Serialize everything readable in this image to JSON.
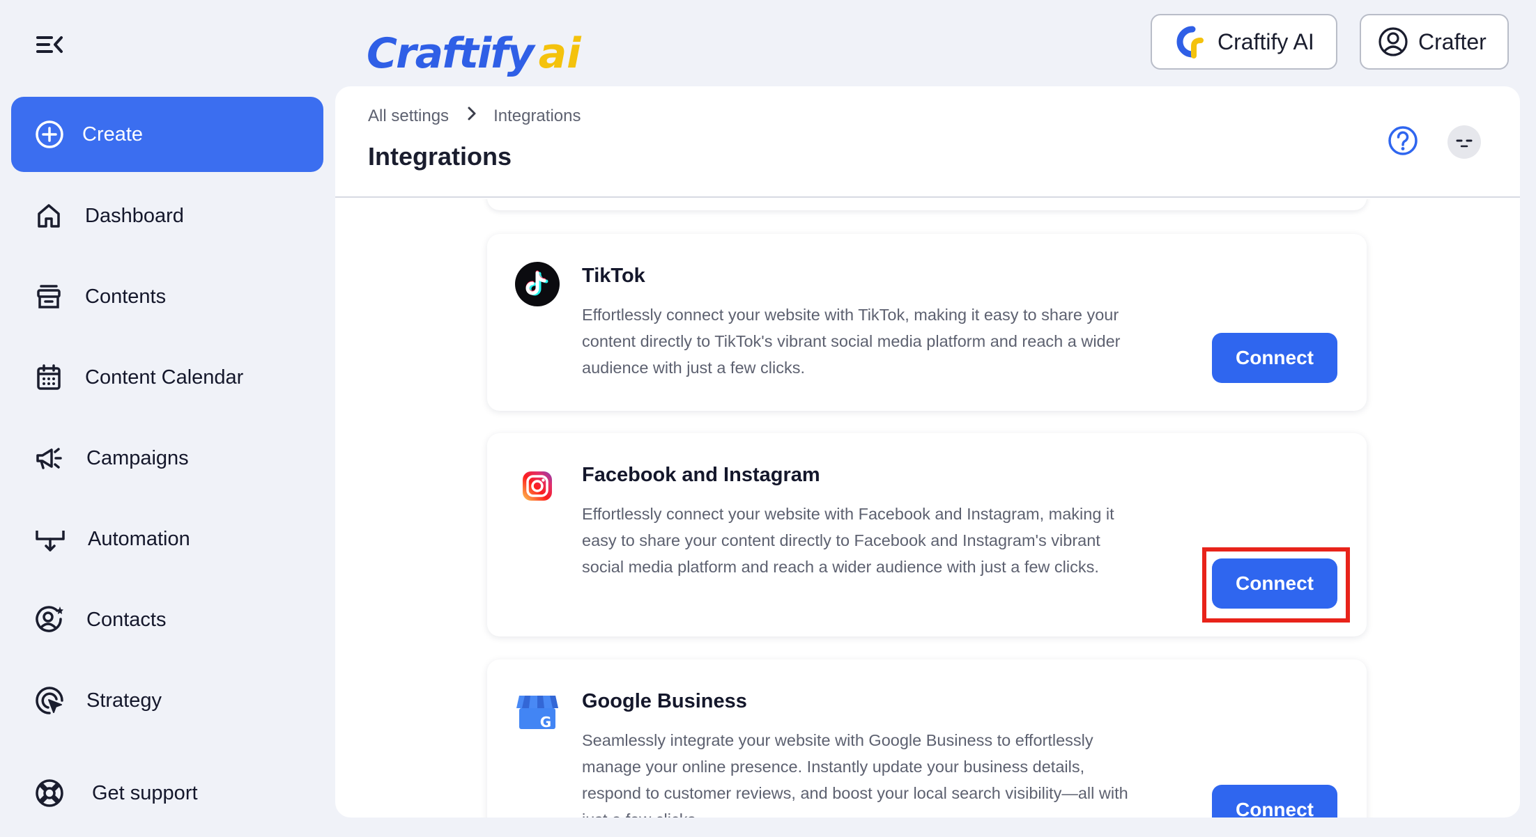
{
  "brand": {
    "logo_word": "Craftify",
    "logo_ai": "ai",
    "primary_color": "#3b6ef0",
    "accent_yellow": "#f4c20d"
  },
  "topbar": {
    "ai_button_label": "Craftify AI",
    "user_button_label": "Crafter"
  },
  "sidebar": {
    "create_label": "Create",
    "items": [
      {
        "label": "Dashboard",
        "icon": "home-icon"
      },
      {
        "label": "Contents",
        "icon": "archive-icon"
      },
      {
        "label": "Content Calendar",
        "icon": "calendar-icon"
      },
      {
        "label": "Campaigns",
        "icon": "megaphone-icon"
      },
      {
        "label": "Automation",
        "icon": "automation-icon"
      },
      {
        "label": "Contacts",
        "icon": "contacts-icon"
      },
      {
        "label": "Strategy",
        "icon": "strategy-icon"
      }
    ],
    "support_label": "Get support"
  },
  "breadcrumb": {
    "root": "All settings",
    "current": "Integrations"
  },
  "page_title": "Integrations",
  "integrations": [
    {
      "name": "TikTok",
      "description": "Effortlessly connect your website with TikTok, making it easy to share your content directly to TikTok's vibrant social media platform and reach a wider audience with just a few clicks.",
      "action": "Connect"
    },
    {
      "name": "Facebook and Instagram",
      "description": "Effortlessly connect your website with Facebook and Instagram, making it easy to share your content directly to Facebook and Instagram's vibrant social media platform and reach a wider audience with just a few clicks.",
      "action": "Connect"
    },
    {
      "name": "Google Business",
      "description": "Seamlessly integrate your website with Google Business to effortlessly manage your online presence. Instantly update your business details, respond to customer reviews, and boost your local search visibility—all with just a few clicks.",
      "action": "Connect"
    }
  ]
}
